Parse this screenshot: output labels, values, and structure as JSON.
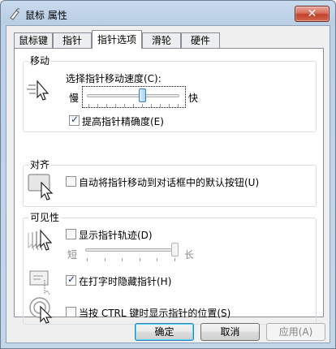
{
  "window": {
    "title": "鼠标 属性",
    "close": "✕"
  },
  "tabs": [
    {
      "label": "鼠标键"
    },
    {
      "label": "指针"
    },
    {
      "label": "指针选项"
    },
    {
      "label": "滑轮"
    },
    {
      "label": "硬件"
    }
  ],
  "motion": {
    "group_label": "移动",
    "speed_label": "选择指针移动速度(C):",
    "slow": "慢",
    "fast": "快",
    "speed_level": 0.6,
    "enhance_precision": {
      "label": "提高指针精确度(E)",
      "checked": true
    }
  },
  "snap_to": {
    "group_label": "对齐",
    "option": {
      "label": "自动将指针移动到对话框中的默认按钮(U)",
      "checked": false
    }
  },
  "visibility": {
    "group_label": "可见性",
    "trails": {
      "label": "显示指针轨迹(D)",
      "checked": false
    },
    "short": "短",
    "long": "长",
    "trail_level": 1.0,
    "hide_typing": {
      "label": "在打字时隐藏指针(H)",
      "checked": true
    },
    "show_ctrl": {
      "label": "当按 CTRL 键时显示指针的位置(S)",
      "checked": false
    }
  },
  "buttons": {
    "ok": "确定",
    "cancel": "取消",
    "apply": "应用(A)"
  }
}
